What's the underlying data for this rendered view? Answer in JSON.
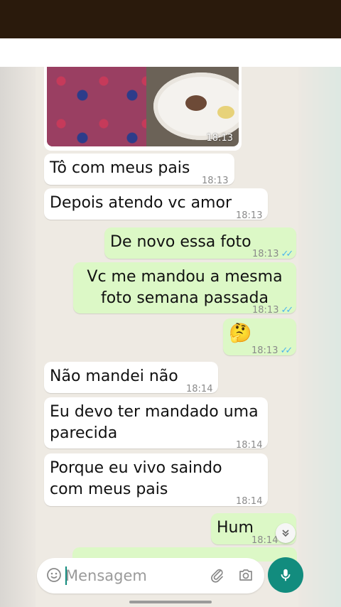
{
  "messages": [
    {
      "id": "m1",
      "text": "Tô com meus pais",
      "time": "18:13"
    },
    {
      "id": "m2",
      "text": "Depois atendo vc amor",
      "time": "18:13"
    },
    {
      "id": "m3",
      "text": "De novo essa foto",
      "time": "18:13"
    },
    {
      "id": "m4",
      "text": "Vc me mandou a mesma\nfoto semana passada",
      "time": "18:13"
    },
    {
      "id": "m5",
      "text": "🤔",
      "time": "18:13"
    },
    {
      "id": "m6",
      "text": "Não mandei não",
      "time": "18:14"
    },
    {
      "id": "m7",
      "text": "Eu devo ter mandado uma\nparecida",
      "time": "18:14"
    },
    {
      "id": "m8",
      "text": "Porque eu vivo saindo\ncom meus pais",
      "time": "18:14"
    },
    {
      "id": "m9",
      "text": "Hum",
      "time": "18:14"
    }
  ],
  "photo": {
    "time": "18:13"
  },
  "composer": {
    "placeholder": "Mensagem"
  },
  "colors": {
    "incoming": "#ffffff",
    "outgoing": "#dcf8c6",
    "accent": "#128c7e",
    "read_ticks": "#4fb6ec"
  },
  "icons": {
    "emoji": "emoji-icon",
    "attach": "paperclip-icon",
    "camera": "camera-icon",
    "mic": "mic-icon",
    "scroll": "chevron-double-down-icon",
    "read": "double-check-icon"
  }
}
